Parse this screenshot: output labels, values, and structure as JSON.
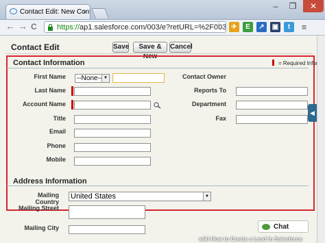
{
  "browser": {
    "tab_title": "Contact Edit: New Contac",
    "tab_close": "×",
    "url_scheme": "https://",
    "url_rest": "ap1.salesforce.com/003/e?retURL=%2F003",
    "window_controls": {
      "minimize": "–",
      "restore": "❐",
      "close": "✕"
    },
    "nav": {
      "back": "←",
      "forward": "→",
      "reload": "C"
    },
    "icons": [
      "lock-icon",
      "star-icon",
      "airplane-icon",
      "evernote-icon",
      "arrow-icon",
      "pocket-icon",
      "twitter-icon",
      "menu-icon"
    ]
  },
  "page": {
    "title": "Contact Edit",
    "buttons": {
      "save": "Save",
      "save_new": "Save & New",
      "cancel": "Cancel"
    },
    "contact_section": {
      "heading": "Contact Information",
      "required_legend": "= Required Infor",
      "salutation_value": "--None--",
      "labels": {
        "first_name": "First Name",
        "last_name": "Last Name",
        "account_name": "Account Name",
        "title": "Title",
        "email": "Email",
        "phone": "Phone",
        "mobile": "Mobile",
        "contact_owner": "Contact Owner",
        "reports_to": "Reports To",
        "department": "Department",
        "fax": "Fax"
      }
    },
    "address_section": {
      "heading": "Address Information",
      "labels": {
        "mailing_country": "Mailing Country",
        "mailing_street": "Mailing Street",
        "mailing_city": "Mailing City"
      },
      "country_value": "United States"
    },
    "chat_label": "Chat",
    "watermark": "wiki How to Create a Lead in Salesforce"
  },
  "colors": {
    "highlight_border": "#d6252e",
    "required_marker": "#cc0000",
    "page_background": "#f3f3ec"
  }
}
